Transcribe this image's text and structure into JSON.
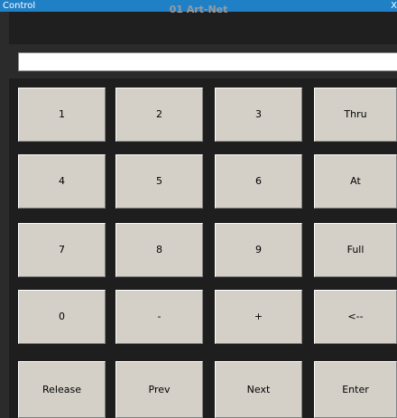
{
  "window": {
    "title": "Control",
    "close_label": "X"
  },
  "header": {
    "device_name": "01 Art-Net"
  },
  "command_line": {
    "value": "",
    "placeholder": ""
  },
  "keypad": {
    "rows": [
      [
        "1",
        "2",
        "3",
        "Thru"
      ],
      [
        "4",
        "5",
        "6",
        "At"
      ],
      [
        "7",
        "8",
        "9",
        "Full"
      ],
      [
        "0",
        "-",
        "+",
        "<--"
      ],
      [
        "Release",
        "Prev",
        "Next",
        "Enter"
      ]
    ]
  },
  "colors": {
    "titlebar": "#1f80c6",
    "background": "#2b2b2b",
    "button_face": "#d4d0c8",
    "header_text": "#9a9a9a"
  }
}
